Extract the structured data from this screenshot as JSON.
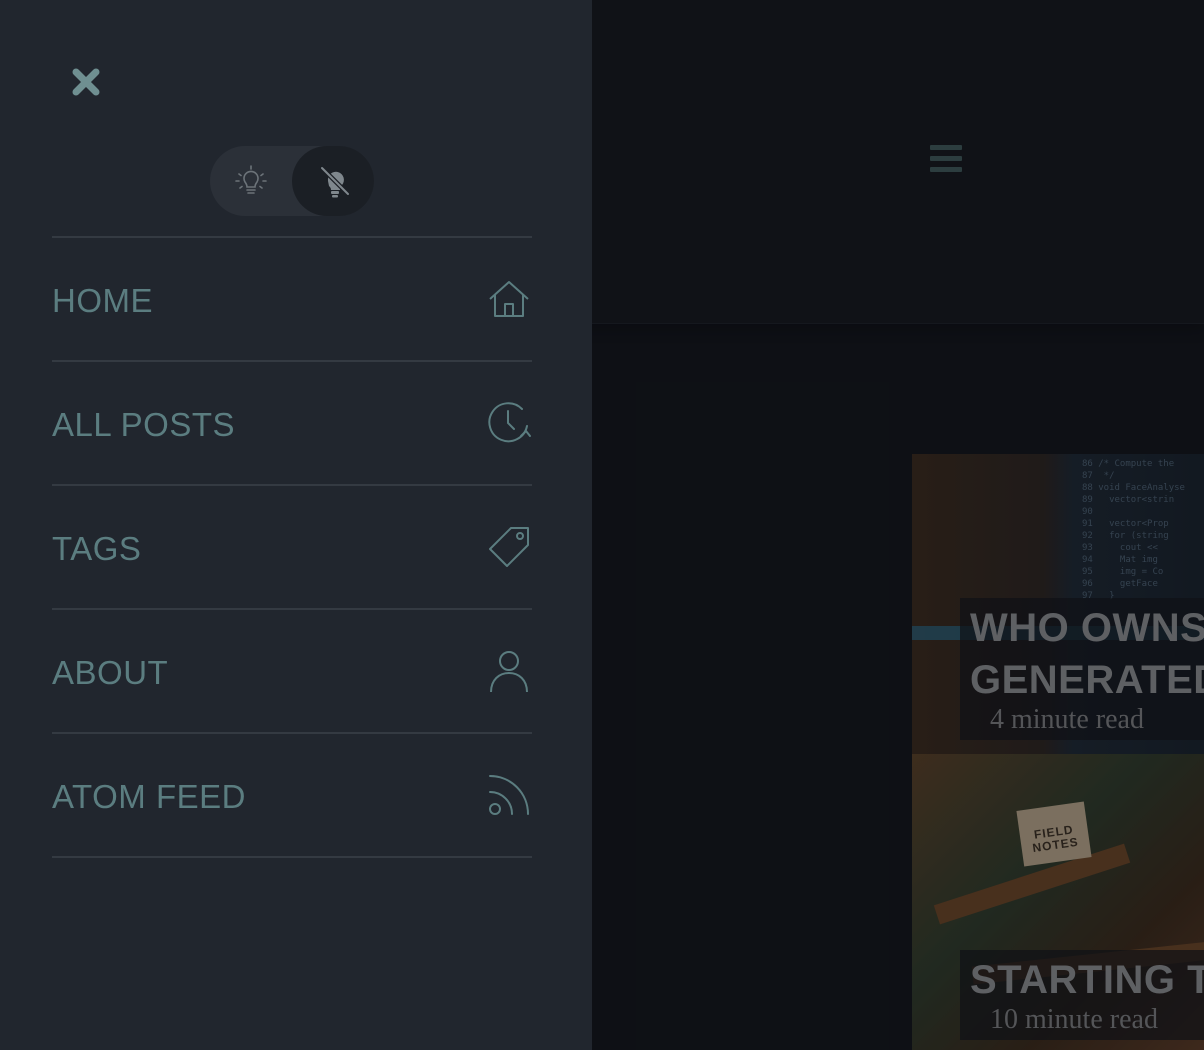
{
  "drawer": {
    "close_icon": "close-icon",
    "theme_toggle": {
      "light_icon": "lightbulb-icon",
      "dark_icon": "lightbulb-off-icon",
      "active": "dark"
    },
    "nav_items": [
      {
        "label": "HOME",
        "icon": "home-icon"
      },
      {
        "label": "ALL POSTS",
        "icon": "clock-icon"
      },
      {
        "label": "TAGS",
        "icon": "tag-icon"
      },
      {
        "label": "ABOUT",
        "icon": "user-icon"
      },
      {
        "label": "ATOM FEED",
        "icon": "rss-icon"
      }
    ]
  },
  "header": {
    "menu_icon": "hamburger-icon"
  },
  "posts": [
    {
      "title_line1": "WHO OWNS",
      "title_line2": "GENERATED",
      "read_time": "4 minute read"
    },
    {
      "title_line1": "STARTING TI",
      "read_time": "10 minute read"
    }
  ],
  "colors": {
    "drawer_bg": "#21262e",
    "page_bg": "#111419",
    "nav_text": "#5b7d80",
    "divider": "#343a42"
  }
}
